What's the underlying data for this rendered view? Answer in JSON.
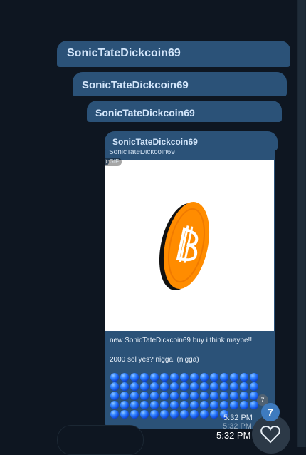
{
  "quoted_senders": [
    "SonicTateDickcoin69",
    "SonicTateDickcoin69",
    "SonicTateDickcoin69",
    "SonicTateDickcoin69"
  ],
  "message": {
    "sender_partial": "SonicTateDickcoin69",
    "gif_badge": "GIF",
    "gif_dot": "0",
    "line1": "new SonicTateDickcoin69 buy i think maybe!!",
    "line2": "2000 sol yes? nigga. (nigga)",
    "emoji_count": 72,
    "emoji_icon": "blue-circle-emoji"
  },
  "timestamps": {
    "inner": "5:32 PM",
    "inner_shadow": "5:32 PM",
    "outer": "5:32 PM"
  },
  "reactions": {
    "big_count": "7",
    "small_count": "7",
    "icon": "heart-icon"
  },
  "colors": {
    "background": "#0e1621",
    "bubble": "#2b5278",
    "coin": "#ff8c00",
    "emoji": "#2f80ff"
  }
}
